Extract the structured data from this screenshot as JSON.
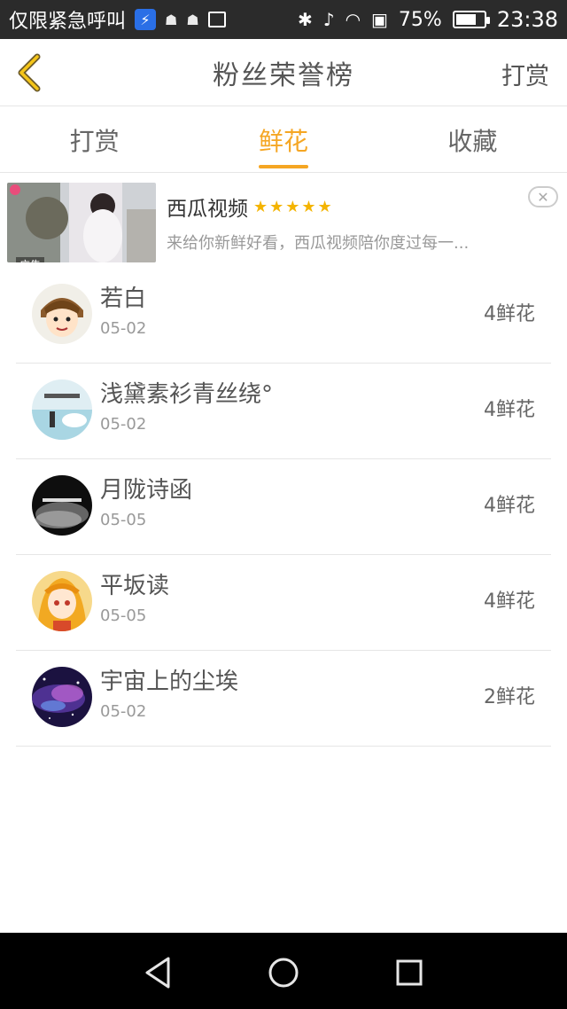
{
  "status_bar": {
    "carrier": "仅限紧急呼叫",
    "battery_percent": "75%",
    "battery_level": 0.75,
    "time": "23:38"
  },
  "header": {
    "title": "粉丝荣誉榜",
    "right_label": "打赏"
  },
  "tabs": [
    {
      "label": "打赏",
      "active": false
    },
    {
      "label": "鲜花",
      "active": true
    },
    {
      "label": "收藏",
      "active": false
    }
  ],
  "ad": {
    "title": "西瓜视频",
    "stars": "★★★★★",
    "description": "来给你新鲜好看，西瓜视频陪你度过每一...",
    "badge": "广告",
    "close_icon": "✕"
  },
  "list": [
    {
      "name": "若白",
      "date": "05-02",
      "count": "4鲜花",
      "avatar": "cartoon-boy"
    },
    {
      "name": "浅黛素衫青丝绕°",
      "date": "05-02",
      "count": "4鲜花",
      "avatar": "sky-girl"
    },
    {
      "name": "月陇诗函",
      "date": "05-05",
      "count": "4鲜花",
      "avatar": "dark-mist"
    },
    {
      "name": "平坂读",
      "date": "05-05",
      "count": "4鲜花",
      "avatar": "anime-girl"
    },
    {
      "name": "宇宙上的尘埃",
      "date": "05-02",
      "count": "2鲜花",
      "avatar": "galaxy"
    }
  ],
  "colors": {
    "accent": "#f5a623",
    "status_bg": "#2b2b2b",
    "divider": "#e6e6e6",
    "text_primary": "#555555",
    "text_secondary": "#999999"
  }
}
